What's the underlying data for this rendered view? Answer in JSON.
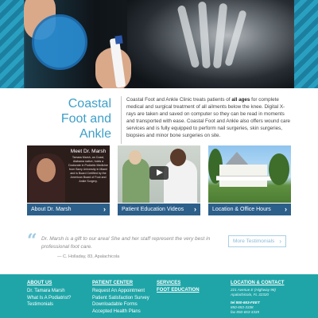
{
  "colors": {
    "accent": "#3d9fc9",
    "card_bar": "#2c5f8a",
    "footer_bg": "#1fa5a8"
  },
  "hero": {
    "icons": [
      "goniometer-image",
      "xray-hand-image"
    ]
  },
  "intro": {
    "title_line1": "Coastal",
    "title_line2": "Foot and Ankle",
    "text_before": "Coastal Foot and Ankle Clinic treats patients of ",
    "text_bold": "all ages",
    "text_after": " for complete medical and surgical treatment of all ailments below the knee. Digital X-rays are taken and saved on computer so they can be read in moments and transported with ease. Coastal Foot and Ankle also offers wound care services and is fully equipped to perform nail surgeries, skin surgeries, biopsies and minor bone surgeries on site."
  },
  "cards": [
    {
      "label": "About Dr. Marsh",
      "overlay_title": "Meet Dr. Marsh",
      "overlay_text": "Tamara Marsh, an Coast, Alabama native, holds a Doctorate in Podiatric Medicine from Barry University in Miami and is Board Certified by the American Board of Foot and Ankle Surgery."
    },
    {
      "label": "Patient Education Videos"
    },
    {
      "label": "Location & Office Hours"
    }
  ],
  "testimonial": {
    "quote": "Dr. Marsh is a gift to our area! She and her staff represent the very best in professional foot care.",
    "author": "— C. Holladay, 83, Apalachicola",
    "more_label": "More Testimonials",
    "chevron": "›"
  },
  "footer": {
    "col1": {
      "heading": "ABOUT US",
      "links": [
        "Dr. Tamara Marsh",
        "What Is A Podiatrist?",
        "Testimonials"
      ]
    },
    "col2": {
      "heading": "PATIENT CENTER",
      "links": [
        "Request An Appointment",
        "Patient Satisfaction Survey",
        "Downloadable Forms",
        "Accepted Health Plans"
      ]
    },
    "col3": {
      "heading1": "SERVICES",
      "heading2": "FOOT EDUCATION"
    },
    "col4": {
      "heading": "LOCATION & CONTACT",
      "address1": "221 Avenue E (Highway 98)",
      "address2": "Apalachicola, FL 32320",
      "phone_main": "tel 850-653-FEET",
      "phone2": "850-653-3338",
      "fax": "fax 850-653-3339"
    }
  }
}
